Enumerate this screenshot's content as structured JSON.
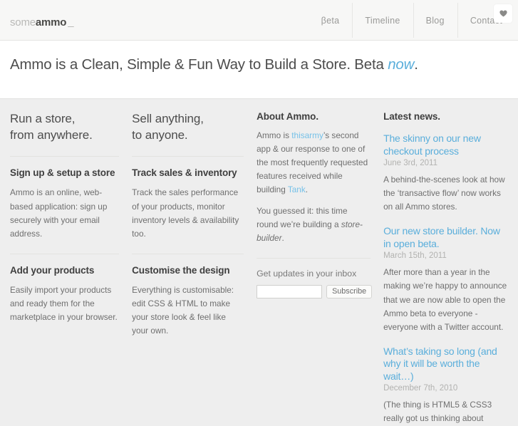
{
  "header": {
    "logo": {
      "light": "some",
      "bold": "ammo",
      "cursor": "_"
    },
    "nav": [
      {
        "label": "βeta"
      },
      {
        "label": "Timeline"
      },
      {
        "label": "Blog"
      },
      {
        "label": "Contact"
      }
    ],
    "heart_icon": "heart-icon"
  },
  "hero": {
    "title_before": "Ammo is a Clean, Simple & Fun Way to Build a Store. Beta ",
    "title_link": "now",
    "title_after": "."
  },
  "columns": {
    "col1": {
      "lede_line1": "Run a store,",
      "lede_line2": "from anywhere.",
      "sections": [
        {
          "heading": "Sign up & setup a store",
          "body": "Ammo is an online, web-based application: sign up securely with your email address."
        },
        {
          "heading": "Add your products",
          "body": "Easily import your products and ready them for the marketplace in your browser."
        }
      ]
    },
    "col2": {
      "lede_line1": "Sell anything,",
      "lede_line2": "to anyone.",
      "sections": [
        {
          "heading": "Track sales & inventory",
          "body": "Track the sales performance of your products, monitor inventory levels & availability too."
        },
        {
          "heading": "Customise the design",
          "body": "Everything is customisable: edit CSS & HTML to make your store look & feel like your own."
        }
      ]
    },
    "col3": {
      "heading": "About Ammo.",
      "p1_part1": "Ammo is ",
      "p1_link1": "thisarmy",
      "p1_part2": "’s second app & our response to one of the most frequently requested features received while building ",
      "p1_link2": "Tank",
      "p1_part3": ".",
      "p2_part1": "You guessed it: this time round we’re building a ",
      "p2_italic": "store-builder",
      "p2_part2": ".",
      "form_label": "Get updates in your inbox",
      "email_value": "",
      "email_placeholder": "",
      "subscribe_label": "Subscribe"
    },
    "col4": {
      "heading": "Latest news.",
      "items": [
        {
          "title": "The skinny on our new checkout process",
          "date": "June 3rd, 2011",
          "excerpt": "A behind-the-scenes look at how the ‘transactive flow’ now works on all Ammo stores."
        },
        {
          "title": "Our new store builder. Now in open beta.",
          "date": "March 15th, 2011",
          "excerpt": "After more than a year in the making we’re happy to announce that we are now able to open the Ammo beta to everyone - everyone with a Twitter account."
        },
        {
          "title": "What’s taking so long (and why it will be worth the wait…)",
          "date": "December 7th, 2010",
          "excerpt": "(The thing is HTML5 & CSS3 really got us thinking about"
        }
      ]
    }
  },
  "colors": {
    "accent_blue": "#5aaedb",
    "link_blue": "#76c1e8",
    "page_bg": "#eeeeee",
    "header_bg": "#f7f7f6"
  }
}
